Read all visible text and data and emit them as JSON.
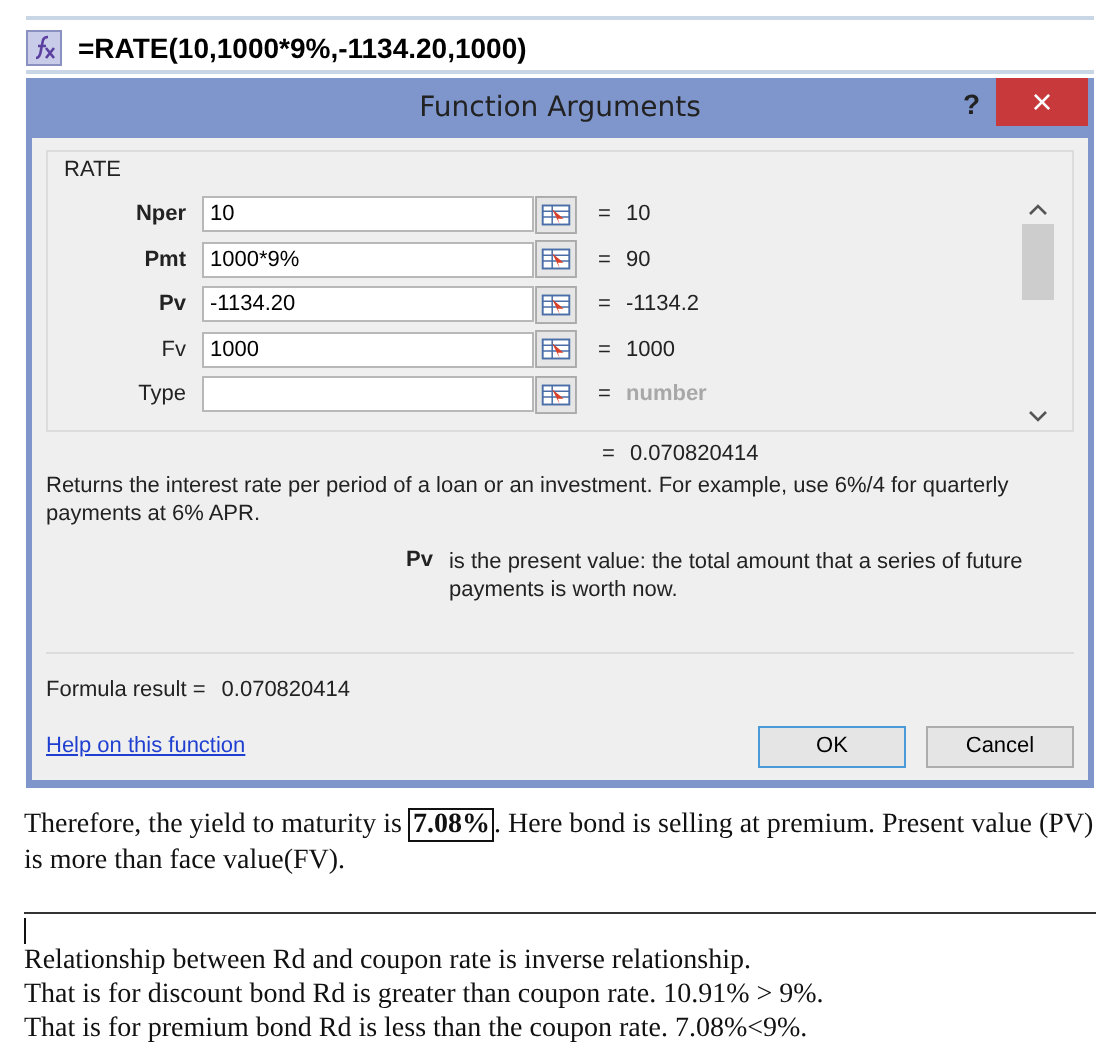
{
  "formula_bar": {
    "formula": "=RATE(10,1000*9%,-1134.20,1000)"
  },
  "dialog": {
    "title": "Function Arguments",
    "help_glyph": "?",
    "close_glyph": "×",
    "group_label": "RATE",
    "arguments": [
      {
        "label": "Nper",
        "required": true,
        "value": "10",
        "result": "10",
        "result_greyed": false
      },
      {
        "label": "Pmt",
        "required": true,
        "value": "1000*9%",
        "result": "90",
        "result_greyed": false
      },
      {
        "label": "Pv",
        "required": true,
        "value": "-1134.20",
        "result": "-1134.2",
        "result_greyed": false
      },
      {
        "label": "Fv",
        "required": false,
        "value": "1000",
        "result": "1000",
        "result_greyed": false
      },
      {
        "label": "Type",
        "required": false,
        "result": "number",
        "result_greyed": true
      }
    ],
    "equals": "=",
    "total_result": "0.070820414",
    "description": "Returns the interest rate per period of a loan or an investment. For example, use 6%/4 for quarterly payments at 6% APR.",
    "argument_help": {
      "name": "Pv",
      "text": "is the present value: the total amount that a series of future payments is worth now."
    },
    "formula_result_label": "Formula result =",
    "formula_result": "0.070820414",
    "help_link": "Help on this function",
    "buttons": [
      "OK",
      "Cancel"
    ]
  },
  "document": {
    "conclusion": {
      "before": "Therefore, the yield to maturity is ",
      "boxed": "7.08%",
      "after": ". Here bond is selling at premium. Present value (PV) is more than face value(FV)."
    },
    "lines": [
      "Relationship between Rd and coupon rate is inverse relationship.",
      "That is for discount bond Rd is greater than coupon rate. 10.91% > 9%.",
      "That is for premium bond Rd is less than the coupon rate. 7.08%<9%."
    ]
  }
}
